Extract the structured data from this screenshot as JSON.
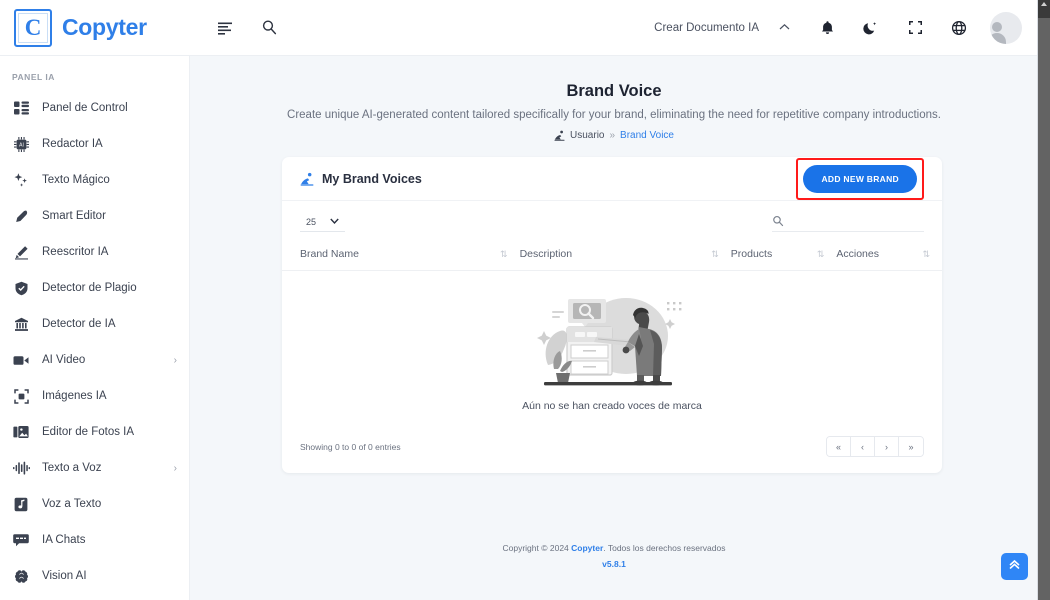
{
  "topbar": {
    "logo_letter": "C",
    "brand": "Copyter",
    "menu_icon": "menu-lines-icon",
    "search_icon": "search-icon",
    "create_doc_label": "Crear Documento IA",
    "chevron_up": "˄",
    "bell_icon": "bell-icon",
    "moon_icon": "moon-icon",
    "compress_icon": "compress-icon",
    "globe_icon": "globe-icon",
    "avatar": "user-avatar"
  },
  "sidebar": {
    "section_label": "PANEL IA",
    "items": [
      {
        "label": "Panel de Control",
        "icon": "dashboard-icon",
        "arrow": ""
      },
      {
        "label": "Redactor IA",
        "icon": "ai-chip-icon",
        "arrow": ""
      },
      {
        "label": "Texto Mágico",
        "icon": "sparkles-icon",
        "arrow": ""
      },
      {
        "label": "Smart Editor",
        "icon": "pen-icon",
        "arrow": ""
      },
      {
        "label": "Reescritor IA",
        "icon": "pencil-icon",
        "arrow": ""
      },
      {
        "label": "Detector de Plagio",
        "icon": "shield-check-icon",
        "arrow": ""
      },
      {
        "label": "Detector de IA",
        "icon": "bank-ai-icon",
        "arrow": ""
      },
      {
        "label": "AI Video",
        "icon": "video-camera-icon",
        "arrow": "›"
      },
      {
        "label": "Imágenes IA",
        "icon": "image-frame-icon",
        "arrow": ""
      },
      {
        "label": "Editor de Fotos IA",
        "icon": "photo-edit-icon",
        "arrow": ""
      },
      {
        "label": "Texto a Voz",
        "icon": "waveform-icon",
        "arrow": "›"
      },
      {
        "label": "Voz a Texto",
        "icon": "music-note-icon",
        "arrow": ""
      },
      {
        "label": "IA Chats",
        "icon": "chat-bubble-icon",
        "arrow": ""
      },
      {
        "label": "Vision AI",
        "icon": "brain-icon",
        "arrow": ""
      }
    ]
  },
  "page": {
    "title": "Brand Voice",
    "subtitle": "Create unique AI-generated content tailored specifically for your brand, eliminating the need for repetitive company introductions.",
    "breadcrumb": {
      "icon": "brand-voice-icon",
      "parent": "Usuario",
      "separator": "»",
      "current": "Brand Voice"
    }
  },
  "card": {
    "icon": "brand-voice-icon",
    "title": "My Brand Voices",
    "add_button": "ADD NEW BRAND",
    "highlight_color": "#ff1a1a",
    "button_color": "#1a73e8"
  },
  "table": {
    "page_length": "25",
    "length_chevron": "⌄",
    "search_icon": "search-icon",
    "search_value": "",
    "search_placeholder": "",
    "columns": [
      {
        "label": "Brand Name",
        "sort": "⇅"
      },
      {
        "label": "Description",
        "sort": "⇅"
      },
      {
        "label": "Products",
        "sort": "⇅"
      },
      {
        "label": "Acciones",
        "sort": "⇅"
      }
    ],
    "rows": [],
    "empty_message": "Aún no se han creado voces de marca",
    "empty_illustration": "person-searching-file-cabinet-illustration",
    "footer_info": "Showing 0 to 0 of 0 entries",
    "pagination": [
      {
        "label": "«",
        "name": "page-first"
      },
      {
        "label": "‹",
        "name": "page-prev"
      },
      {
        "label": "›",
        "name": "page-next"
      },
      {
        "label": "»",
        "name": "page-last"
      }
    ]
  },
  "footer": {
    "copyright_pre": "Copyright © 2024 ",
    "brand": "Copyter",
    "copyright_post": ". Todos los derechos reservados",
    "version": "v5.8.1"
  },
  "scroll_top": {
    "icon": "double-chevron-up-icon"
  },
  "colors": {
    "accent": "#2f7fe8",
    "button": "#1a73e8",
    "page_bg": "#f4f7fa",
    "card_bg": "#ffffff",
    "highlight": "#ff1a1a"
  }
}
